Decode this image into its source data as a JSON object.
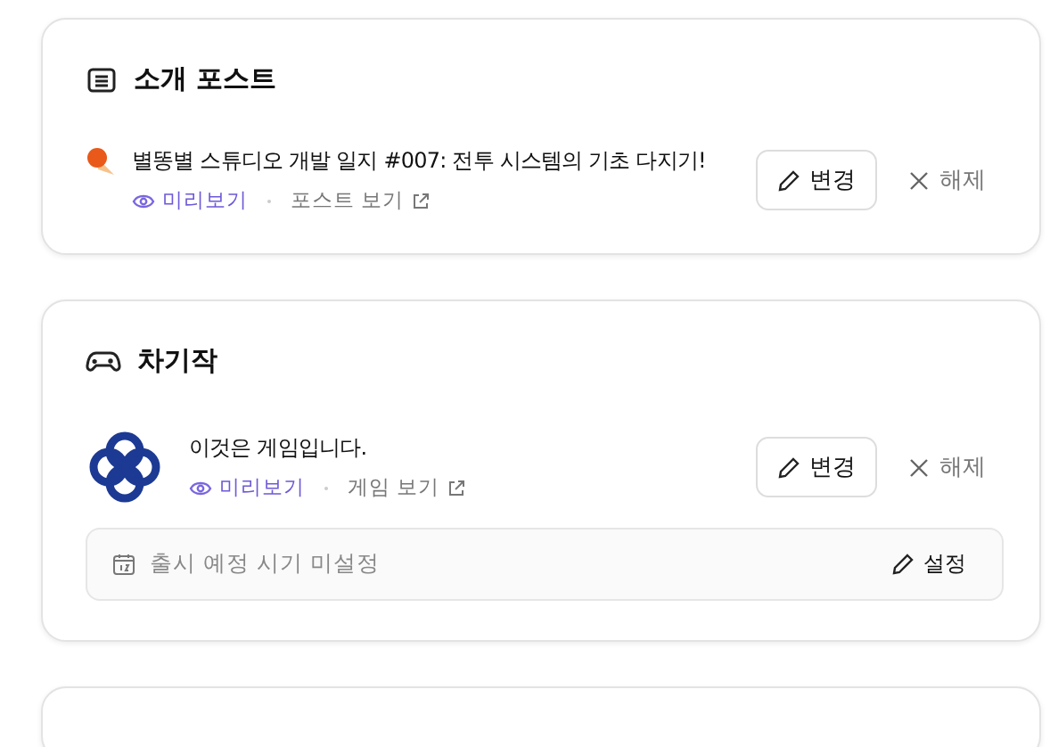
{
  "sections": [
    {
      "kind": "post",
      "title": "소개 포스트",
      "item": {
        "title": "별똥별 스튜디오 개발 일지 #007: 전투 시스템의 기초 다지기!",
        "preview": "미리보기",
        "view": "포스트 보기",
        "change": "변경",
        "remove": "해제"
      }
    },
    {
      "kind": "game",
      "title": "차기작",
      "item": {
        "title": "이것은 게임입니다.",
        "preview": "미리보기",
        "view": "게임 보기",
        "change": "변경",
        "remove": "해제"
      },
      "release": {
        "text": "출시 예정 시기 미설정",
        "action": "설정"
      }
    }
  ]
}
